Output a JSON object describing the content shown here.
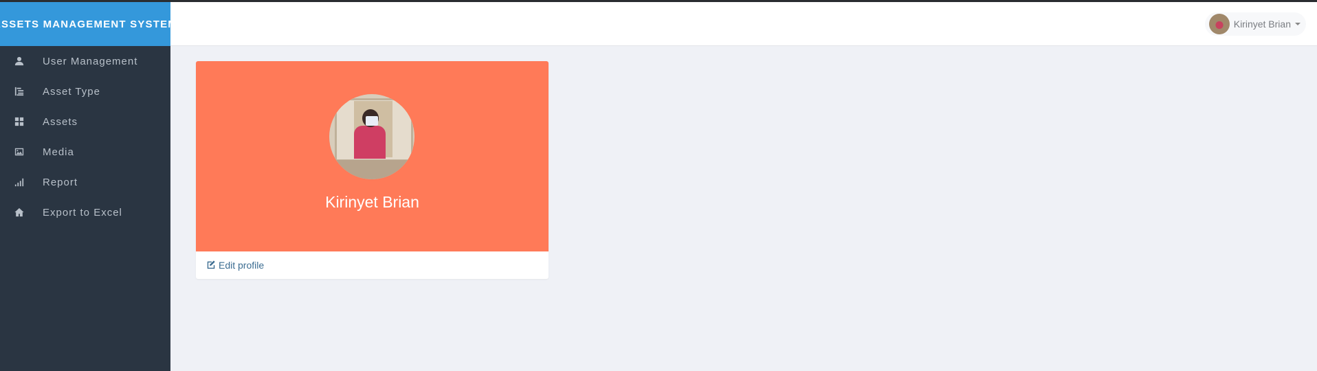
{
  "app": {
    "brand_title": "ASSETS MANAGEMENT SYSTEM"
  },
  "header": {
    "user_name": "Kirinyet Brian"
  },
  "sidebar": {
    "items": [
      {
        "label": "User Management",
        "icon": "user-icon"
      },
      {
        "label": "Asset Type",
        "icon": "list-tree-icon"
      },
      {
        "label": "Assets",
        "icon": "grid-icon"
      },
      {
        "label": "Media",
        "icon": "image-icon"
      },
      {
        "label": "Report",
        "icon": "signal-bars-icon"
      },
      {
        "label": "Export to Excel",
        "icon": "home-icon"
      }
    ]
  },
  "profile": {
    "name": "Kirinyet Brian",
    "edit_label": "Edit profile"
  },
  "colors": {
    "brand": "#3498db",
    "sidebar": "#2a3542",
    "card_hero": "#ff7a58",
    "link": "#3b6c91"
  }
}
